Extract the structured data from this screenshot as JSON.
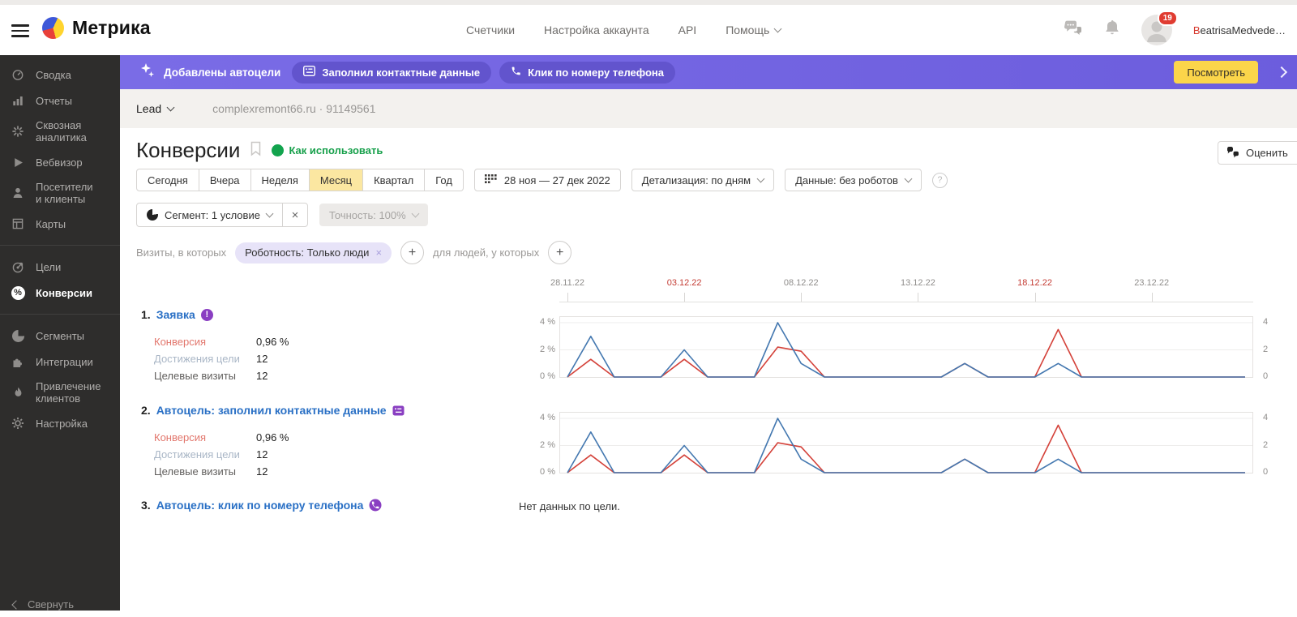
{
  "header": {
    "brand": "Метрика",
    "nav": [
      {
        "label": "Счетчики"
      },
      {
        "label": "Настройка аккаунта"
      },
      {
        "label": "API"
      },
      {
        "label": "Помощь"
      }
    ],
    "user": {
      "badge": "19",
      "name_initial": "B",
      "name_rest": "eatrisaMedvede…"
    }
  },
  "banner": {
    "title": "Добавлены автоцели",
    "pills": [
      {
        "label": "Заполнил контактные данные",
        "icon": "form-icon"
      },
      {
        "label": "Клик по номеру телефона",
        "icon": "phone-icon"
      }
    ],
    "action": "Посмотреть",
    "bg_color": "#7264e1",
    "action_bg": "#fbd54a"
  },
  "counter_bar": {
    "counter_name": "Lead",
    "site": "complexremont66.ru",
    "separator": "·",
    "counter_id": "91149561"
  },
  "page": {
    "title": "Конверсии",
    "help_link": "Как использовать",
    "rate_button": "Оценить"
  },
  "toolbar": {
    "periods": [
      "Сегодня",
      "Вчера",
      "Неделя",
      "Месяц",
      "Квартал",
      "Год"
    ],
    "selected_period": "Месяц",
    "date_range": "28 ноя — 27 дек 2022",
    "detalization": "Детализация: по дням",
    "data_filter": "Данные: без роботов"
  },
  "segment_bar": {
    "segment": "Сегмент: 1 условие",
    "accuracy": "Точность: 100%"
  },
  "filter_bar": {
    "visits_label": "Визиты, в которых",
    "chip": "Роботность: Только люди",
    "people_label": "для людей, у которых"
  },
  "sidebar": {
    "groups": [
      [
        {
          "id": "svodka",
          "label": "Сводка",
          "icon": "gauge-icon"
        },
        {
          "id": "otchety",
          "label": "Отчеты",
          "icon": "bar-chart-icon"
        },
        {
          "id": "skvoznaya-analitika",
          "label": "Сквозная\nаналитика",
          "icon": "burst-icon"
        },
        {
          "id": "vebvizor",
          "label": "Вебвизор",
          "icon": "play-icon"
        },
        {
          "id": "posetiteli-i-klienty",
          "label": "Посетители\nи клиенты",
          "icon": "person-icon"
        },
        {
          "id": "karty",
          "label": "Карты",
          "icon": "layout-icon"
        }
      ],
      [
        {
          "id": "celi",
          "label": "Цели",
          "icon": "target-icon"
        },
        {
          "id": "konversii",
          "label": "Конверсии",
          "icon": "percent-icon",
          "active": true
        }
      ],
      [
        {
          "id": "segmenty",
          "label": "Сегменты",
          "icon": "pie-icon"
        },
        {
          "id": "integracii",
          "label": "Интеграции",
          "icon": "puzzle-icon"
        },
        {
          "id": "privlechenie-klientov",
          "label": "Привлечение\nклиентов",
          "icon": "flame-icon"
        },
        {
          "id": "nastroyka",
          "label": "Настройка",
          "icon": "gear-icon"
        }
      ]
    ],
    "collapse": "Свернуть"
  },
  "goals": [
    {
      "num": "1.",
      "name": "Заявка",
      "icon": "exclamation-badge-icon",
      "stats": {
        "conversion_label": "Конверсия",
        "conversion_value": "0,96 %",
        "reaches_label": "Достижения цели",
        "reaches_value": "12",
        "visits_label": "Целевые визиты",
        "visits_value": "12"
      }
    },
    {
      "num": "2.",
      "name": "Автоцель: заполнил контактные данные",
      "icon": "form-badge-icon",
      "stats": {
        "conversion_label": "Конверсия",
        "conversion_value": "0,96 %",
        "reaches_label": "Достижения цели",
        "reaches_value": "12",
        "visits_label": "Целевые визиты",
        "visits_value": "12"
      }
    },
    {
      "num": "3.",
      "name": "Автоцель: клик по номеру телефона",
      "icon": "phone-badge-icon",
      "no_data": "Нет данных по цели."
    }
  ],
  "chart_data": [
    {
      "type": "line",
      "title": "Заявка",
      "x": [
        "28.11",
        "29.11",
        "30.11",
        "01.12",
        "02.12",
        "03.12",
        "04.12",
        "05.12",
        "06.12",
        "07.12",
        "08.12",
        "09.12",
        "10.12",
        "11.12",
        "12.12",
        "13.12",
        "14.12",
        "15.12",
        "16.12",
        "17.12",
        "18.12",
        "19.12",
        "20.12",
        "21.12",
        "22.12",
        "23.12",
        "24.12",
        "25.12",
        "26.12",
        "27.12"
      ],
      "x_tick_labels": [
        "28.11.22",
        "03.12.22",
        "08.12.22",
        "13.12.22",
        "18.12.22",
        "23.12.22"
      ],
      "weekend_tick_labels": [
        "03.12.22",
        "18.12.22"
      ],
      "series": [
        {
          "name": "Конверсия, %",
          "axis": "left",
          "color": "#d4423a",
          "values": [
            0,
            1.3,
            0,
            0,
            0,
            1.3,
            0,
            0,
            0,
            2.2,
            1.9,
            0,
            0,
            0,
            0,
            0,
            0,
            1,
            0,
            0,
            0,
            3.5,
            0,
            0,
            0,
            0,
            0,
            0,
            0,
            0
          ]
        },
        {
          "name": "Достижения цели",
          "axis": "right",
          "color": "#4478b0",
          "values": [
            0,
            3,
            0,
            0,
            0,
            2,
            0,
            0,
            0,
            4,
            1,
            0,
            0,
            0,
            0,
            0,
            0,
            1,
            0,
            0,
            0,
            1,
            0,
            0,
            0,
            0,
            0,
            0,
            0,
            0
          ]
        }
      ],
      "ylim": [
        0,
        4.5
      ],
      "yticks_left": [
        "0 %",
        "2 %",
        "4 %"
      ],
      "yticks_right": [
        "0",
        "2",
        "4"
      ],
      "grid": true,
      "legend_position": "none"
    },
    {
      "type": "line",
      "title": "Автоцель: заполнил контактные данные",
      "x": [
        "28.11",
        "29.11",
        "30.11",
        "01.12",
        "02.12",
        "03.12",
        "04.12",
        "05.12",
        "06.12",
        "07.12",
        "08.12",
        "09.12",
        "10.12",
        "11.12",
        "12.12",
        "13.12",
        "14.12",
        "15.12",
        "16.12",
        "17.12",
        "18.12",
        "19.12",
        "20.12",
        "21.12",
        "22.12",
        "23.12",
        "24.12",
        "25.12",
        "26.12",
        "27.12"
      ],
      "x_tick_labels": [
        "28.11.22",
        "03.12.22",
        "08.12.22",
        "13.12.22",
        "18.12.22",
        "23.12.22"
      ],
      "weekend_tick_labels": [
        "03.12.22",
        "18.12.22"
      ],
      "series": [
        {
          "name": "Конверсия, %",
          "axis": "left",
          "color": "#d4423a",
          "values": [
            0,
            1.3,
            0,
            0,
            0,
            1.3,
            0,
            0,
            0,
            2.2,
            1.9,
            0,
            0,
            0,
            0,
            0,
            0,
            1,
            0,
            0,
            0,
            3.5,
            0,
            0,
            0,
            0,
            0,
            0,
            0,
            0
          ]
        },
        {
          "name": "Достижения цели",
          "axis": "right",
          "color": "#4478b0",
          "values": [
            0,
            3,
            0,
            0,
            0,
            2,
            0,
            0,
            0,
            4,
            1,
            0,
            0,
            0,
            0,
            0,
            0,
            1,
            0,
            0,
            0,
            1,
            0,
            0,
            0,
            0,
            0,
            0,
            0,
            0
          ]
        }
      ],
      "ylim": [
        0,
        4.5
      ],
      "yticks_left": [
        "0 %",
        "2 %",
        "4 %"
      ],
      "yticks_right": [
        "0",
        "2",
        "4"
      ],
      "grid": true,
      "legend_position": "none"
    }
  ]
}
